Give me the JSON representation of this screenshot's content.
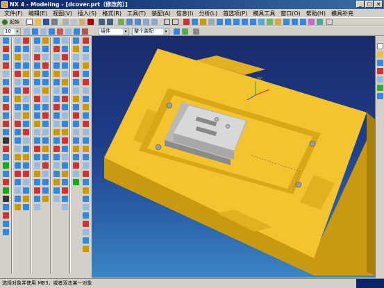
{
  "window": {
    "title": "NX 4 - Modeling - [dcover.prt（修改的）]",
    "controls": [
      "_",
      "□",
      "×"
    ]
  },
  "menu": {
    "items": [
      {
        "label": "文件(F)"
      },
      {
        "label": "编辑(E)"
      },
      {
        "label": "视图(V)"
      },
      {
        "label": "插入(S)"
      },
      {
        "label": "格式(R)"
      },
      {
        "label": "工具(T)"
      },
      {
        "label": "装配(A)"
      },
      {
        "label": "信息(I)"
      },
      {
        "label": "分析(L)"
      },
      {
        "label": "首选项(P)"
      },
      {
        "label": "模具工具"
      },
      {
        "label": "窗口(O)"
      },
      {
        "label": "帮助(H)"
      },
      {
        "label": "模具补充"
      }
    ]
  },
  "toolbar": {
    "start_label": "起始",
    "layer_value": "10",
    "filter_value": "组件",
    "assembly_value": "整个装配"
  },
  "viewport": {
    "triad": {
      "x_label": "XC",
      "y_label": "YC",
      "z_label": "ZC"
    }
  },
  "status": {
    "message": "选择对象并使用 MB3，或者双击某一对象"
  },
  "colors": {
    "titlebar": "#0a246a",
    "mold_base": "#f4c430",
    "mold_shadow": "#c99a10",
    "viewport_top": "#1a2a6c",
    "viewport_bottom": "#3a86c4"
  }
}
